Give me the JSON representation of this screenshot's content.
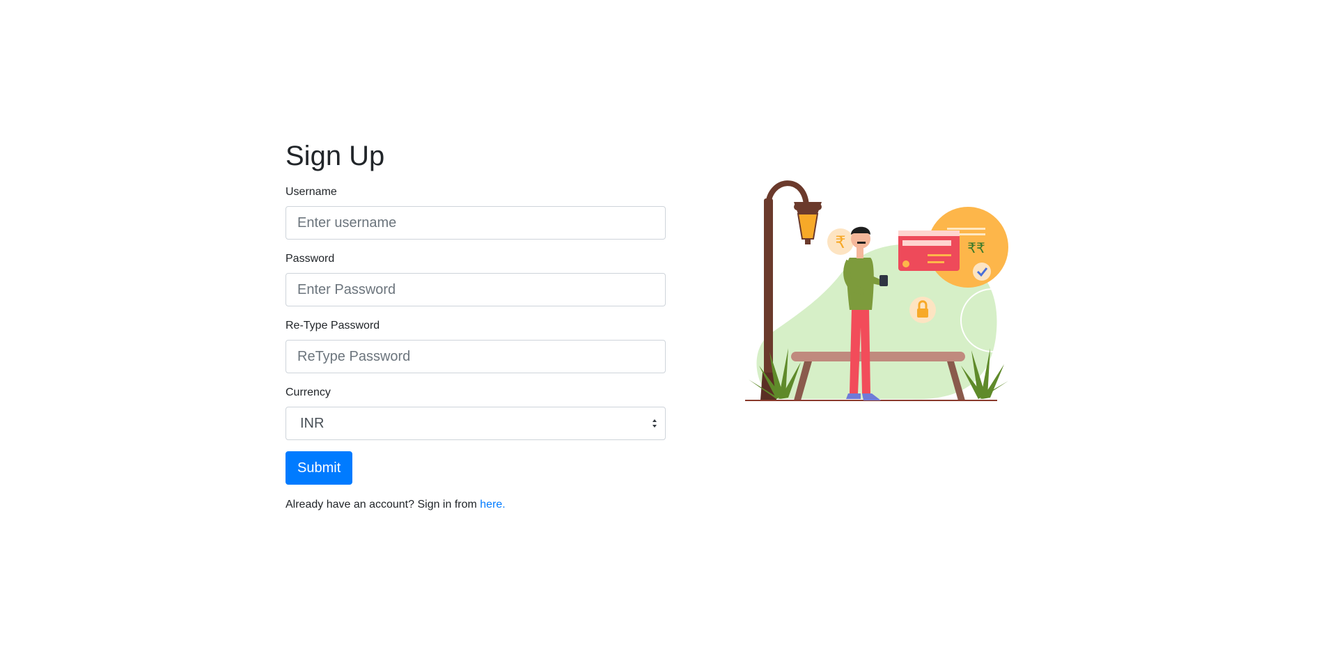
{
  "form": {
    "title": "Sign Up",
    "username": {
      "label": "Username",
      "placeholder": "Enter username",
      "value": ""
    },
    "password": {
      "label": "Password",
      "placeholder": "Enter Password",
      "value": ""
    },
    "retype_password": {
      "label": "Re-Type Password",
      "placeholder": "ReType Password",
      "value": ""
    },
    "currency": {
      "label": "Currency",
      "selected": "INR"
    },
    "submit_label": "Submit",
    "signin_prompt": "Already have an account? Sign in from ",
    "signin_link": "here."
  },
  "colors": {
    "primary": "#007bff",
    "text": "#212529",
    "border": "#ced4da"
  },
  "illustration": {
    "subject": "man-with-phone-payment-illustration",
    "currency_symbol": "₹",
    "card_currency_symbols": "₹₹"
  }
}
